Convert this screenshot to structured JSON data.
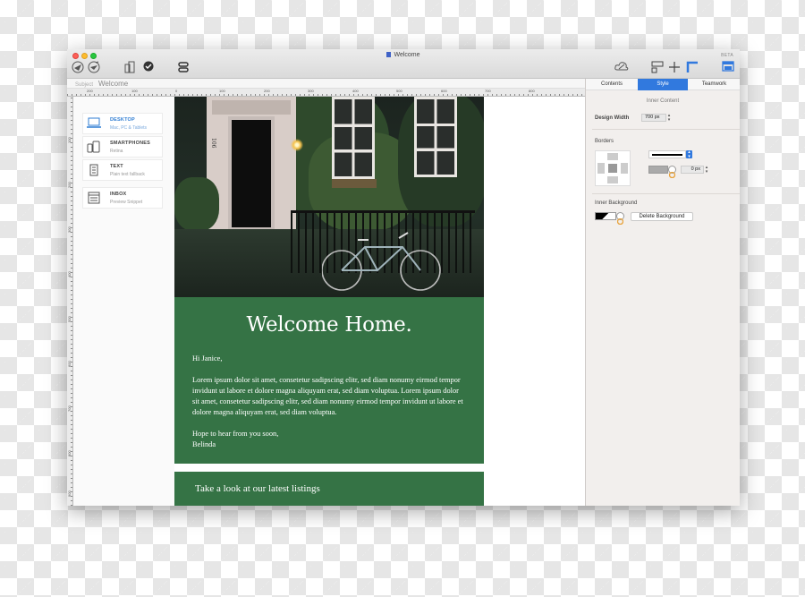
{
  "window": {
    "title": "Welcome",
    "badge": "BETA"
  },
  "subject": {
    "label": "Subject",
    "value": "Welcome"
  },
  "ruler": {
    "top_ticks": [
      "200",
      "100",
      "0",
      "100",
      "200",
      "300",
      "400",
      "500",
      "600",
      "700",
      "800"
    ],
    "left_ticks": [
      "100",
      "200",
      "300",
      "400",
      "500",
      "600",
      "700",
      "800",
      "900",
      "1000"
    ]
  },
  "devices": [
    {
      "title": "DESKTOP",
      "subtitle": "Mac, PC & Tablets",
      "icon": "laptop-icon",
      "active": true
    },
    {
      "title": "SMARTPHONES",
      "subtitle": "Retina",
      "icon": "phone-icon",
      "active": false
    },
    {
      "title": "TEXT",
      "subtitle": "Plain text fallback",
      "icon": "text-document-icon",
      "active": false
    },
    {
      "title": "INBOX",
      "subtitle": "Preview Snippet",
      "icon": "inbox-icon",
      "active": false
    }
  ],
  "email": {
    "house_number": "106",
    "headline": "Welcome Home.",
    "greeting": "Hi Janice,",
    "paragraph": "Lorem ipsum dolor sit amet, consetetur sadipscing elitr, sed diam nonumy eirmod tempor invidunt ut labore et dolore magna aliquyam erat, sed diam voluptua. Lorem ipsum dolor sit amet, consetetur sadipscing elitr, sed diam nonumy eirmod tempor invidunt ut labore et dolore magna aliquyam erat, sed diam voluptua.",
    "closing_1": "Hope to hear from you soon,",
    "closing_2": "Belinda",
    "listings_heading": "Take a look at our latest listings",
    "section_color": "#357345"
  },
  "panel": {
    "tabs": [
      {
        "label": "Contents",
        "active": false
      },
      {
        "label": "Style",
        "active": true
      },
      {
        "label": "Teamwork",
        "active": false
      }
    ],
    "section_title": "Inner Content",
    "design_width_label": "Design Width",
    "design_width_value": "700 px",
    "borders_label": "Borders",
    "border_width_value": "0 px",
    "inner_background_label": "Inner Background",
    "delete_background_label": "Delete Background"
  },
  "colors": {
    "accent": "#3179de",
    "email_green": "#357345"
  }
}
